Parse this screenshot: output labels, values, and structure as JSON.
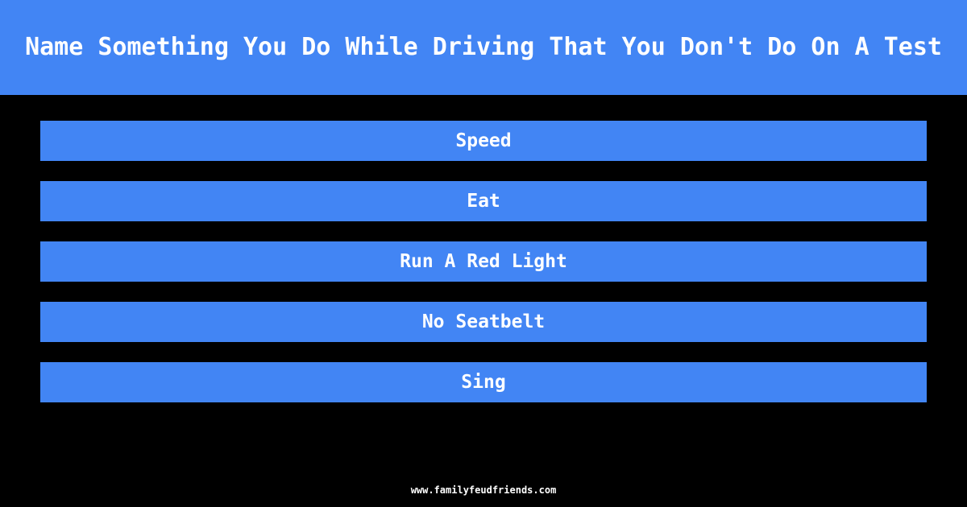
{
  "page": {
    "background_color": "#000000",
    "accent_color": "#4285f4",
    "text_color": "#ffffff"
  },
  "header": {
    "title": "Name Something You Do While Driving That You Don't Do On A Test"
  },
  "answers": {
    "items": [
      {
        "label": "Speed"
      },
      {
        "label": "Eat"
      },
      {
        "label": "Run A Red Light"
      },
      {
        "label": "No Seatbelt"
      },
      {
        "label": "Sing"
      }
    ]
  },
  "footer": {
    "site": "www.familyfeudfriends.com"
  }
}
